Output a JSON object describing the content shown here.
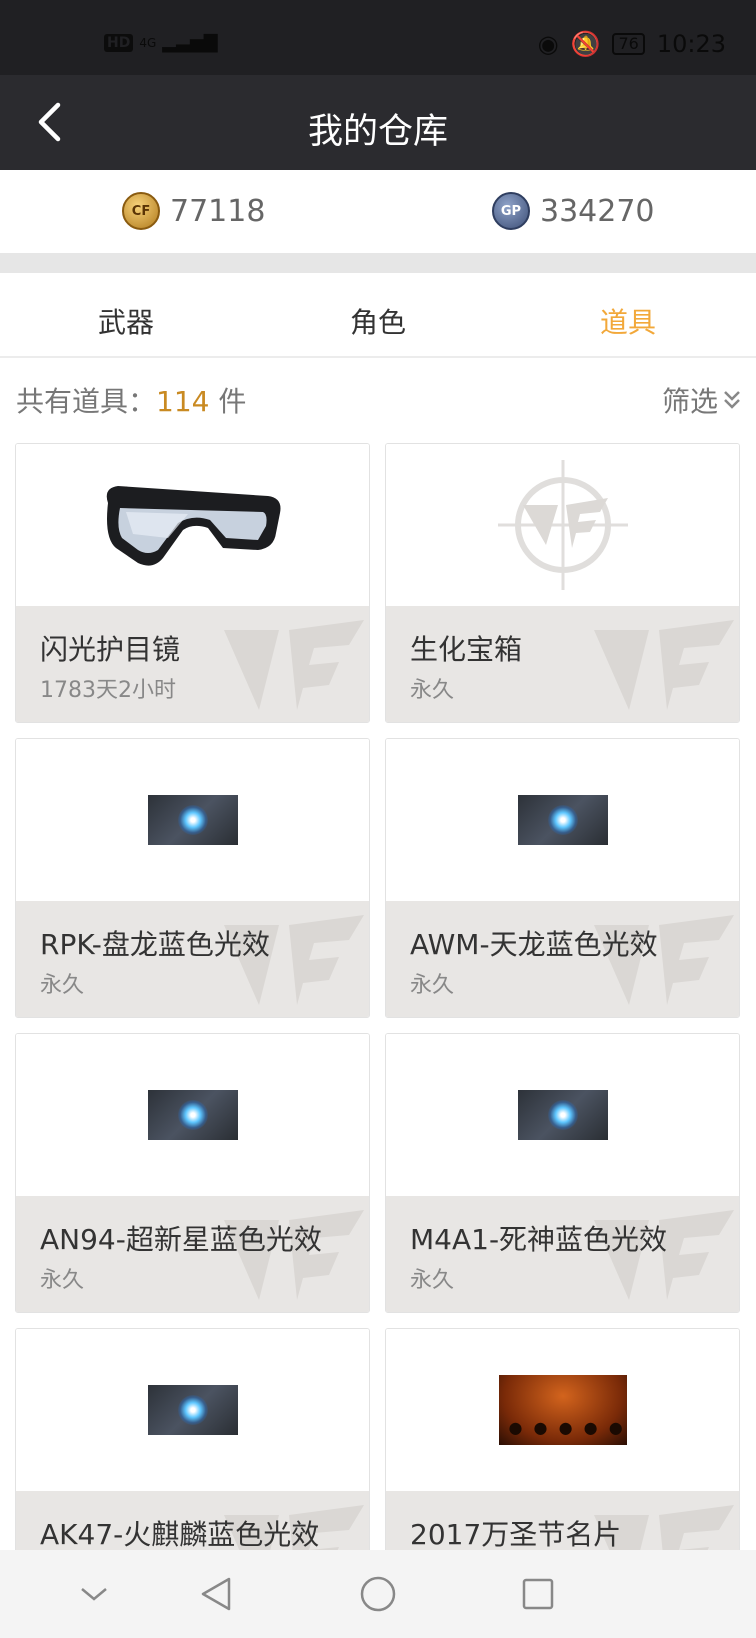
{
  "status_bar": {
    "network": "HD",
    "signal": "4G",
    "battery": "76",
    "time": "10:23"
  },
  "header": {
    "title": "我的仓库",
    "back_icon": "chevron-left-icon"
  },
  "currency": {
    "cf_points": "77118",
    "gp_points": "334270",
    "cf_coin_label": "CF",
    "gp_coin_label": "GP"
  },
  "tabs": [
    {
      "label": "武器",
      "active": false
    },
    {
      "label": "角色",
      "active": false
    },
    {
      "label": "道具",
      "active": true
    }
  ],
  "summary": {
    "prefix": "共有道具：",
    "count": "114",
    "suffix": " 件",
    "filter_label": "筛选"
  },
  "items": [
    {
      "name": "闪光护目镜",
      "duration": "1783天2小时",
      "icon": "goggles-image"
    },
    {
      "name": "生化宝箱",
      "duration": "永久",
      "icon": "cf-logo-placeholder"
    },
    {
      "name": "RPK-盘龙蓝色光效",
      "duration": "永久",
      "icon": "blue-effect-image"
    },
    {
      "name": "AWM-天龙蓝色光效",
      "duration": "永久",
      "icon": "blue-effect-image"
    },
    {
      "name": "AN94-超新星蓝色光效",
      "duration": "永久",
      "icon": "blue-effect-image"
    },
    {
      "name": "M4A1-死神蓝色光效",
      "duration": "永久",
      "icon": "blue-effect-image"
    },
    {
      "name": "AK47-火麒麟蓝色光效",
      "duration": "",
      "icon": "blue-effect-image"
    },
    {
      "name": "2017万圣节名片",
      "duration": "",
      "icon": "halloween-card-image"
    }
  ],
  "colors": {
    "accent": "#f2a83a",
    "header_bg": "#2b2b2f",
    "count_color": "#c98a22"
  }
}
